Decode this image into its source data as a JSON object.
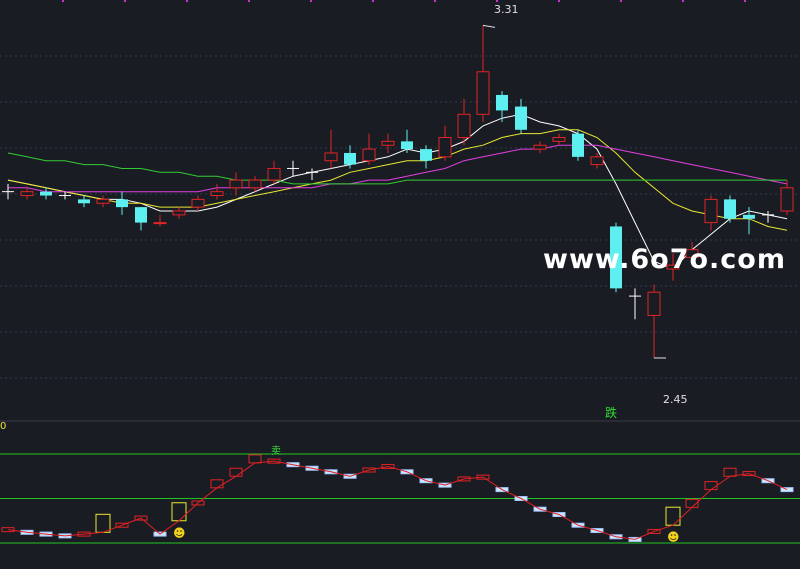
{
  "chart_data": [
    {
      "type": "candlestick",
      "panel": "price",
      "high_marker": "3.31",
      "low_marker": "2.45",
      "signal_label": "跌",
      "ylim": [
        2.3,
        3.36
      ],
      "candles": [
        {
          "o": 2.88,
          "c": 2.88,
          "h": 2.9,
          "l": 2.86,
          "color": "white"
        },
        {
          "o": 2.88,
          "c": 2.87,
          "h": 2.89,
          "l": 2.86,
          "color": "red"
        },
        {
          "o": 2.88,
          "c": 2.87,
          "h": 2.89,
          "l": 2.86,
          "color": "cyan"
        },
        {
          "o": 2.87,
          "c": 2.87,
          "h": 2.88,
          "l": 2.86,
          "color": "white"
        },
        {
          "o": 2.86,
          "c": 2.85,
          "h": 2.87,
          "l": 2.84,
          "color": "cyan"
        },
        {
          "o": 2.85,
          "c": 2.86,
          "h": 2.87,
          "l": 2.84,
          "color": "red"
        },
        {
          "o": 2.86,
          "c": 2.84,
          "h": 2.88,
          "l": 2.82,
          "color": "cyan"
        },
        {
          "o": 2.84,
          "c": 2.8,
          "h": 2.84,
          "l": 2.78,
          "color": "cyan"
        },
        {
          "o": 2.8,
          "c": 2.8,
          "h": 2.82,
          "l": 2.79,
          "color": "red"
        },
        {
          "o": 2.82,
          "c": 2.83,
          "h": 2.84,
          "l": 2.81,
          "color": "red"
        },
        {
          "o": 2.84,
          "c": 2.86,
          "h": 2.87,
          "l": 2.83,
          "color": "red"
        },
        {
          "o": 2.87,
          "c": 2.88,
          "h": 2.9,
          "l": 2.86,
          "color": "red"
        },
        {
          "o": 2.89,
          "c": 2.91,
          "h": 2.93,
          "l": 2.87,
          "color": "red"
        },
        {
          "o": 2.89,
          "c": 2.91,
          "h": 2.92,
          "l": 2.88,
          "color": "red"
        },
        {
          "o": 2.91,
          "c": 2.94,
          "h": 2.96,
          "l": 2.9,
          "color": "red"
        },
        {
          "o": 2.94,
          "c": 2.94,
          "h": 2.96,
          "l": 2.92,
          "color": "white"
        },
        {
          "o": 2.93,
          "c": 2.93,
          "h": 2.94,
          "l": 2.91,
          "color": "white"
        },
        {
          "o": 2.96,
          "c": 2.98,
          "h": 3.04,
          "l": 2.94,
          "color": "red"
        },
        {
          "o": 2.98,
          "c": 2.95,
          "h": 3.0,
          "l": 2.94,
          "color": "cyan"
        },
        {
          "o": 2.96,
          "c": 2.99,
          "h": 3.03,
          "l": 2.95,
          "color": "red"
        },
        {
          "o": 3.0,
          "c": 3.01,
          "h": 3.03,
          "l": 2.98,
          "color": "red"
        },
        {
          "o": 3.01,
          "c": 2.99,
          "h": 3.04,
          "l": 2.98,
          "color": "cyan"
        },
        {
          "o": 2.99,
          "c": 2.96,
          "h": 3.0,
          "l": 2.94,
          "color": "cyan"
        },
        {
          "o": 2.97,
          "c": 3.02,
          "h": 3.05,
          "l": 2.96,
          "color": "red"
        },
        {
          "o": 3.02,
          "c": 3.08,
          "h": 3.12,
          "l": 3.0,
          "color": "red"
        },
        {
          "o": 3.08,
          "c": 3.19,
          "h": 3.31,
          "l": 3.06,
          "color": "red"
        },
        {
          "o": 3.13,
          "c": 3.09,
          "h": 3.14,
          "l": 3.06,
          "color": "cyan"
        },
        {
          "o": 3.1,
          "c": 3.04,
          "h": 3.12,
          "l": 3.03,
          "color": "cyan"
        },
        {
          "o": 3.0,
          "c": 2.99,
          "h": 3.01,
          "l": 2.98,
          "color": "red"
        },
        {
          "o": 3.01,
          "c": 3.02,
          "h": 3.03,
          "l": 3.0,
          "color": "red"
        },
        {
          "o": 3.03,
          "c": 2.97,
          "h": 3.04,
          "l": 2.96,
          "color": "cyan"
        },
        {
          "o": 2.95,
          "c": 2.97,
          "h": 2.98,
          "l": 2.94,
          "color": "red"
        },
        {
          "o": 2.79,
          "c": 2.63,
          "h": 2.8,
          "l": 2.62,
          "color": "cyan"
        },
        {
          "o": 2.61,
          "c": 2.61,
          "h": 2.63,
          "l": 2.55,
          "color": "white"
        },
        {
          "o": 2.56,
          "c": 2.62,
          "h": 2.64,
          "l": 2.45,
          "color": "red"
        },
        {
          "o": 2.68,
          "c": 2.69,
          "h": 2.72,
          "l": 2.65,
          "color": "red"
        },
        {
          "o": 2.71,
          "c": 2.73,
          "h": 2.75,
          "l": 2.69,
          "color": "red"
        },
        {
          "o": 2.8,
          "c": 2.86,
          "h": 2.87,
          "l": 2.78,
          "color": "red"
        },
        {
          "o": 2.86,
          "c": 2.81,
          "h": 2.87,
          "l": 2.8,
          "color": "cyan"
        },
        {
          "o": 2.82,
          "c": 2.81,
          "h": 2.84,
          "l": 2.77,
          "color": "cyan"
        },
        {
          "o": 2.82,
          "c": 2.82,
          "h": 2.83,
          "l": 2.8,
          "color": "white"
        },
        {
          "o": 2.83,
          "c": 2.89,
          "h": 2.91,
          "l": 2.82,
          "color": "red"
        }
      ],
      "series": [
        {
          "color": "#ffffff",
          "values": [
            2.91,
            2.9,
            2.89,
            2.88,
            2.87,
            2.86,
            2.86,
            2.85,
            2.83,
            2.83,
            2.83,
            2.84,
            2.86,
            2.88,
            2.9,
            2.92,
            2.93,
            2.94,
            2.95,
            2.96,
            2.97,
            2.99,
            2.98,
            2.99,
            3.01,
            3.05,
            3.07,
            3.08,
            3.06,
            3.05,
            3.03,
            2.99,
            2.9,
            2.8,
            2.7,
            2.68,
            2.73,
            2.77,
            2.81,
            2.83,
            2.82,
            2.81
          ]
        },
        {
          "color": "#e8e830",
          "values": [
            2.91,
            2.9,
            2.89,
            2.88,
            2.87,
            2.86,
            2.85,
            2.85,
            2.84,
            2.84,
            2.84,
            2.85,
            2.86,
            2.87,
            2.88,
            2.89,
            2.9,
            2.91,
            2.93,
            2.94,
            2.95,
            2.96,
            2.96,
            2.97,
            2.99,
            3.0,
            3.02,
            3.03,
            3.03,
            3.04,
            3.04,
            3.02,
            2.98,
            2.93,
            2.89,
            2.85,
            2.83,
            2.82,
            2.81,
            2.81,
            2.79,
            2.78
          ]
        },
        {
          "color": "#e040e0",
          "values": [
            2.89,
            2.89,
            2.88,
            2.88,
            2.88,
            2.88,
            2.88,
            2.88,
            2.88,
            2.88,
            2.88,
            2.89,
            2.89,
            2.89,
            2.89,
            2.89,
            2.89,
            2.9,
            2.9,
            2.91,
            2.91,
            2.92,
            2.93,
            2.94,
            2.96,
            2.97,
            2.98,
            2.99,
            2.99,
            3.0,
            3.0,
            3.0,
            2.99,
            2.98,
            2.97,
            2.96,
            2.95,
            2.94,
            2.93,
            2.92,
            2.91,
            2.9
          ]
        },
        {
          "color": "#33cc33",
          "values": [
            2.98,
            2.97,
            2.96,
            2.96,
            2.95,
            2.95,
            2.94,
            2.94,
            2.93,
            2.93,
            2.92,
            2.92,
            2.91,
            2.91,
            2.91,
            2.9,
            2.9,
            2.9,
            2.9,
            2.9,
            2.9,
            2.91,
            2.91,
            2.91,
            2.91,
            2.91,
            2.91,
            2.91,
            2.91,
            2.91,
            2.91,
            2.91,
            2.91,
            2.91,
            2.91,
            2.91,
            2.91,
            2.91,
            2.91,
            2.91,
            2.91,
            2.91
          ]
        }
      ]
    },
    {
      "type": "step-indicator",
      "panel": "indicator",
      "zero_label": "0",
      "peak_label": "卖",
      "levels": [
        100,
        50,
        0
      ],
      "ylim": [
        -5,
        105
      ],
      "values": [
        15,
        12,
        10,
        8,
        10,
        12,
        20,
        28,
        10,
        25,
        45,
        62,
        75,
        90,
        92,
        88,
        84,
        80,
        75,
        82,
        86,
        80,
        70,
        65,
        72,
        74,
        60,
        50,
        38,
        32,
        20,
        14,
        7,
        4,
        13,
        20,
        40,
        60,
        75,
        78,
        70,
        60
      ],
      "highlight_boxes": [
        5,
        9,
        35
      ],
      "smileys": [
        9,
        35
      ]
    }
  ],
  "watermark": "www.6o7o.com"
}
